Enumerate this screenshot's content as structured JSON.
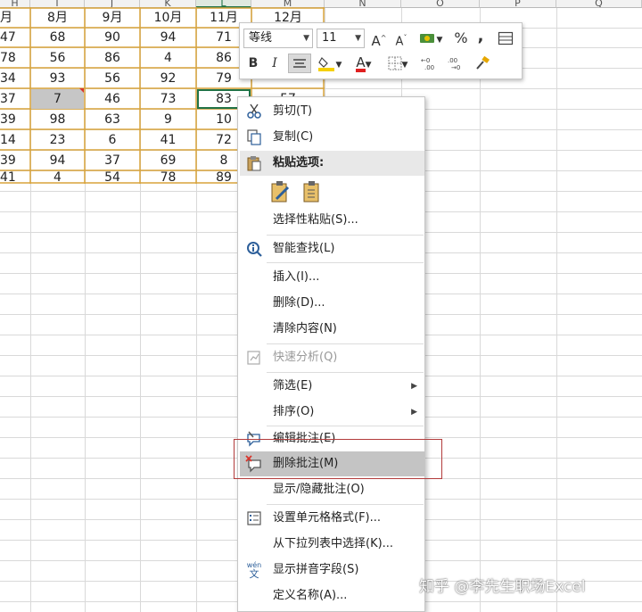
{
  "sheet": {
    "columns": [
      "H",
      "I",
      "J",
      "K",
      "L",
      "M",
      "N",
      "O",
      "P",
      "Q"
    ],
    "selected_column": "L",
    "header_row": [
      "月",
      "8月",
      "9月",
      "10月",
      "11月",
      "12月"
    ],
    "rows": [
      [
        "47",
        "68",
        "90",
        "94",
        "71",
        ""
      ],
      [
        "78",
        "56",
        "86",
        "4",
        "86",
        ""
      ],
      [
        "34",
        "93",
        "56",
        "92",
        "79",
        ""
      ],
      [
        "37",
        "7",
        "46",
        "73",
        "83",
        "57"
      ],
      [
        "39",
        "98",
        "63",
        "9",
        "10",
        ""
      ],
      [
        "14",
        "23",
        "6",
        "41",
        "72",
        ""
      ],
      [
        "39",
        "94",
        "37",
        "69",
        "8",
        ""
      ],
      [
        "41",
        "4",
        "54",
        "78",
        "89",
        ""
      ]
    ],
    "selected_cell_value": "7",
    "active_cell_value": "83",
    "colors": {
      "orange_border": "#d9a43a",
      "selection_green": "#217346",
      "comment_marker": "#d9342b"
    }
  },
  "mini_toolbar": {
    "font_name": "等线",
    "font_size": "11",
    "grow_font": "A",
    "shrink_font": "A",
    "percent": "%",
    "comma": ",",
    "bold": "B",
    "italic": "I",
    "font_color_letter": "A",
    "colors": {
      "fill": "#f5d000",
      "font": "#e02020"
    }
  },
  "context_menu": {
    "items": [
      {
        "label": "剪切(T)",
        "icon": "scissors-icon"
      },
      {
        "label": "复制(C)",
        "icon": "copy-icon"
      },
      {
        "label": "粘贴选项:",
        "icon": "paste-icon"
      },
      {
        "label": "选择性粘贴(S)...",
        "icon": ""
      },
      {
        "label": "智能查找(L)",
        "icon": "smart-lookup-icon"
      },
      {
        "label": "插入(I)...",
        "icon": ""
      },
      {
        "label": "删除(D)...",
        "icon": ""
      },
      {
        "label": "清除内容(N)",
        "icon": ""
      },
      {
        "label": "快速分析(Q)",
        "icon": "quick-analysis-icon"
      },
      {
        "label": "筛选(E)",
        "icon": ""
      },
      {
        "label": "排序(O)",
        "icon": ""
      },
      {
        "label": "编辑批注(E)",
        "icon": "edit-comment-icon"
      },
      {
        "label": "删除批注(M)",
        "icon": "delete-comment-icon"
      },
      {
        "label": "显示/隐藏批注(O)",
        "icon": ""
      },
      {
        "label": "设置单元格格式(F)...",
        "icon": "format-cells-icon"
      },
      {
        "label": "从下拉列表中选择(K)...",
        "icon": ""
      },
      {
        "label": "显示拼音字段(S)",
        "icon": "phonetic-icon"
      },
      {
        "label": "定义名称(A)...",
        "icon": ""
      }
    ],
    "phonetic_icon_text": "wén",
    "phonetic_icon_char": "文"
  },
  "watermark": "知乎 @李先生职场Excel"
}
